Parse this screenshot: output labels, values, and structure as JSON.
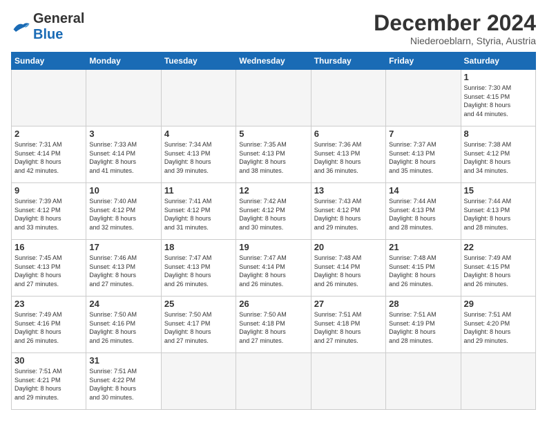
{
  "logo": {
    "text1": "General",
    "text2": "Blue"
  },
  "title": {
    "month": "December 2024",
    "location": "Niederoeblarn, Styria, Austria"
  },
  "weekdays": [
    "Sunday",
    "Monday",
    "Tuesday",
    "Wednesday",
    "Thursday",
    "Friday",
    "Saturday"
  ],
  "days": [
    {
      "num": "",
      "info": ""
    },
    {
      "num": "",
      "info": ""
    },
    {
      "num": "",
      "info": ""
    },
    {
      "num": "",
      "info": ""
    },
    {
      "num": "",
      "info": ""
    },
    {
      "num": "",
      "info": ""
    },
    {
      "num": "1",
      "info": "Sunrise: 7:30 AM\nSunset: 4:15 PM\nDaylight: 8 hours\nand 44 minutes."
    },
    {
      "num": "2",
      "info": "Sunrise: 7:31 AM\nSunset: 4:14 PM\nDaylight: 8 hours\nand 42 minutes."
    },
    {
      "num": "3",
      "info": "Sunrise: 7:33 AM\nSunset: 4:14 PM\nDaylight: 8 hours\nand 41 minutes."
    },
    {
      "num": "4",
      "info": "Sunrise: 7:34 AM\nSunset: 4:13 PM\nDaylight: 8 hours\nand 39 minutes."
    },
    {
      "num": "5",
      "info": "Sunrise: 7:35 AM\nSunset: 4:13 PM\nDaylight: 8 hours\nand 38 minutes."
    },
    {
      "num": "6",
      "info": "Sunrise: 7:36 AM\nSunset: 4:13 PM\nDaylight: 8 hours\nand 36 minutes."
    },
    {
      "num": "7",
      "info": "Sunrise: 7:37 AM\nSunset: 4:13 PM\nDaylight: 8 hours\nand 35 minutes."
    },
    {
      "num": "8",
      "info": "Sunrise: 7:38 AM\nSunset: 4:12 PM\nDaylight: 8 hours\nand 34 minutes."
    },
    {
      "num": "9",
      "info": "Sunrise: 7:39 AM\nSunset: 4:12 PM\nDaylight: 8 hours\nand 33 minutes."
    },
    {
      "num": "10",
      "info": "Sunrise: 7:40 AM\nSunset: 4:12 PM\nDaylight: 8 hours\nand 32 minutes."
    },
    {
      "num": "11",
      "info": "Sunrise: 7:41 AM\nSunset: 4:12 PM\nDaylight: 8 hours\nand 31 minutes."
    },
    {
      "num": "12",
      "info": "Sunrise: 7:42 AM\nSunset: 4:12 PM\nDaylight: 8 hours\nand 30 minutes."
    },
    {
      "num": "13",
      "info": "Sunrise: 7:43 AM\nSunset: 4:12 PM\nDaylight: 8 hours\nand 29 minutes."
    },
    {
      "num": "14",
      "info": "Sunrise: 7:44 AM\nSunset: 4:13 PM\nDaylight: 8 hours\nand 28 minutes."
    },
    {
      "num": "15",
      "info": "Sunrise: 7:44 AM\nSunset: 4:13 PM\nDaylight: 8 hours\nand 28 minutes."
    },
    {
      "num": "16",
      "info": "Sunrise: 7:45 AM\nSunset: 4:13 PM\nDaylight: 8 hours\nand 27 minutes."
    },
    {
      "num": "17",
      "info": "Sunrise: 7:46 AM\nSunset: 4:13 PM\nDaylight: 8 hours\nand 27 minutes."
    },
    {
      "num": "18",
      "info": "Sunrise: 7:47 AM\nSunset: 4:13 PM\nDaylight: 8 hours\nand 26 minutes."
    },
    {
      "num": "19",
      "info": "Sunrise: 7:47 AM\nSunset: 4:14 PM\nDaylight: 8 hours\nand 26 minutes."
    },
    {
      "num": "20",
      "info": "Sunrise: 7:48 AM\nSunset: 4:14 PM\nDaylight: 8 hours\nand 26 minutes."
    },
    {
      "num": "21",
      "info": "Sunrise: 7:48 AM\nSunset: 4:15 PM\nDaylight: 8 hours\nand 26 minutes."
    },
    {
      "num": "22",
      "info": "Sunrise: 7:49 AM\nSunset: 4:15 PM\nDaylight: 8 hours\nand 26 minutes."
    },
    {
      "num": "23",
      "info": "Sunrise: 7:49 AM\nSunset: 4:16 PM\nDaylight: 8 hours\nand 26 minutes."
    },
    {
      "num": "24",
      "info": "Sunrise: 7:50 AM\nSunset: 4:16 PM\nDaylight: 8 hours\nand 26 minutes."
    },
    {
      "num": "25",
      "info": "Sunrise: 7:50 AM\nSunset: 4:17 PM\nDaylight: 8 hours\nand 27 minutes."
    },
    {
      "num": "26",
      "info": "Sunrise: 7:50 AM\nSunset: 4:18 PM\nDaylight: 8 hours\nand 27 minutes."
    },
    {
      "num": "27",
      "info": "Sunrise: 7:51 AM\nSunset: 4:18 PM\nDaylight: 8 hours\nand 27 minutes."
    },
    {
      "num": "28",
      "info": "Sunrise: 7:51 AM\nSunset: 4:19 PM\nDaylight: 8 hours\nand 28 minutes."
    },
    {
      "num": "29",
      "info": "Sunrise: 7:51 AM\nSunset: 4:20 PM\nDaylight: 8 hours\nand 29 minutes."
    },
    {
      "num": "30",
      "info": "Sunrise: 7:51 AM\nSunset: 4:21 PM\nDaylight: 8 hours\nand 29 minutes."
    },
    {
      "num": "31",
      "info": "Sunrise: 7:51 AM\nSunset: 4:22 PM\nDaylight: 8 hours\nand 30 minutes."
    },
    {
      "num": "",
      "info": ""
    },
    {
      "num": "",
      "info": ""
    },
    {
      "num": "",
      "info": ""
    },
    {
      "num": "",
      "info": ""
    },
    {
      "num": "",
      "info": ""
    }
  ]
}
